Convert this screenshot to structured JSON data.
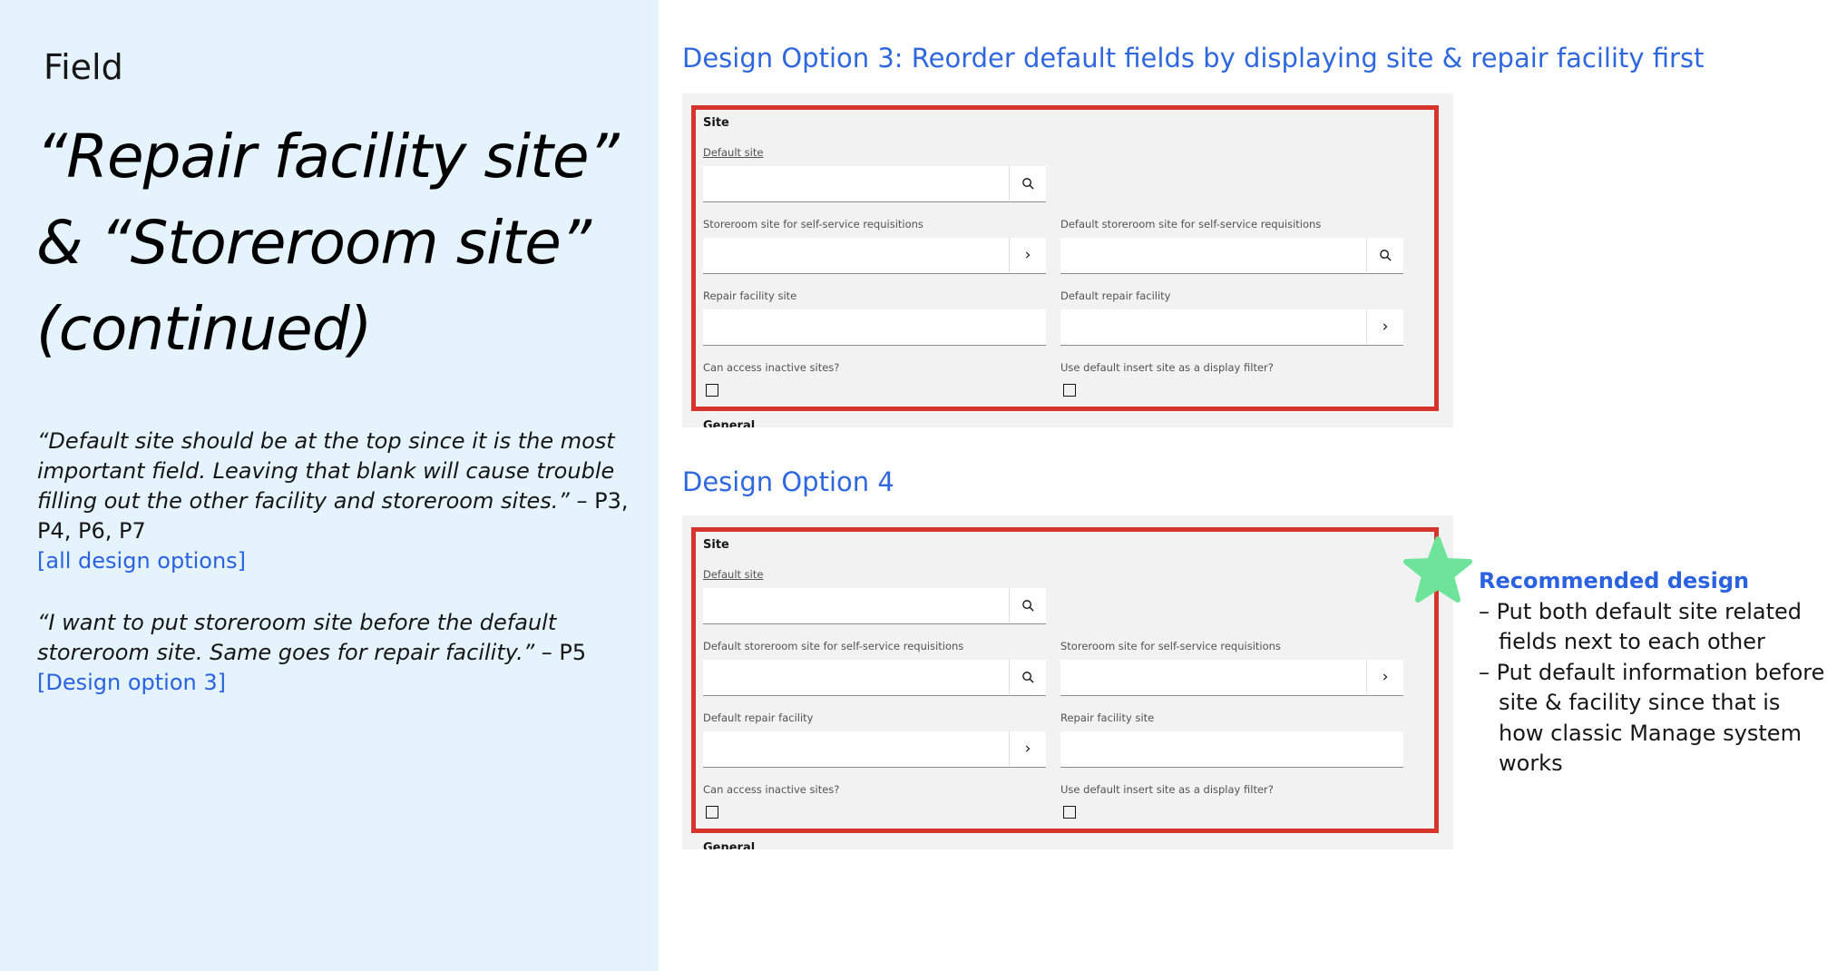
{
  "left": {
    "kicker": "Field",
    "title_lines": [
      "“Repair facility site”",
      "& “Storeroom site”",
      "(continued)"
    ],
    "quote1": {
      "text": "“Default site should be at the top since it is the most important field. Leaving that blank will cause trouble filling out the other facility and storeroom sites.”",
      "attribution": " – P3, P4, P6, P7",
      "link": "[all design options]"
    },
    "quote2": {
      "text": "“I want to put storeroom site before the default storeroom site. Same goes for repair facility.”",
      "attribution": " – P5",
      "link": "[Design option 3]"
    }
  },
  "option3": {
    "heading": "Design Option 3: Reorder default fields by displaying site & repair facility first",
    "section": "Site",
    "default_site": "Default site",
    "row1_left": "Storeroom site for self-service requisitions",
    "row1_right": "Default storeroom site for self-service requisitions",
    "row2_left": "Repair facility site",
    "row2_right": "Default repair facility",
    "row3_left": "Can access inactive sites?",
    "row3_right": "Use default insert site as a display filter?",
    "next_section": "General"
  },
  "option4": {
    "heading": "Design Option 4",
    "section": "Site",
    "default_site": "Default site",
    "row1_left": "Default storeroom site for self-service requisitions",
    "row1_right": "Storeroom site for self-service requisitions",
    "row2_left": "Default repair facility",
    "row2_right": "Repair facility site",
    "row3_left": "Can access inactive sites?",
    "row3_right": "Use default insert site as a display filter?",
    "next_section": "General"
  },
  "recommendation": {
    "icon": "star-icon",
    "star_color": "#6ee39a",
    "title": "Recommended design",
    "items": [
      "– Put both default site related fields next to each other",
      "– Put default information before site & facility since that is how classic Manage system works"
    ]
  },
  "colors": {
    "left_panel": "#e5f3fc",
    "accent_blue": "#2f68de",
    "highlight_red": "#d6342c"
  }
}
